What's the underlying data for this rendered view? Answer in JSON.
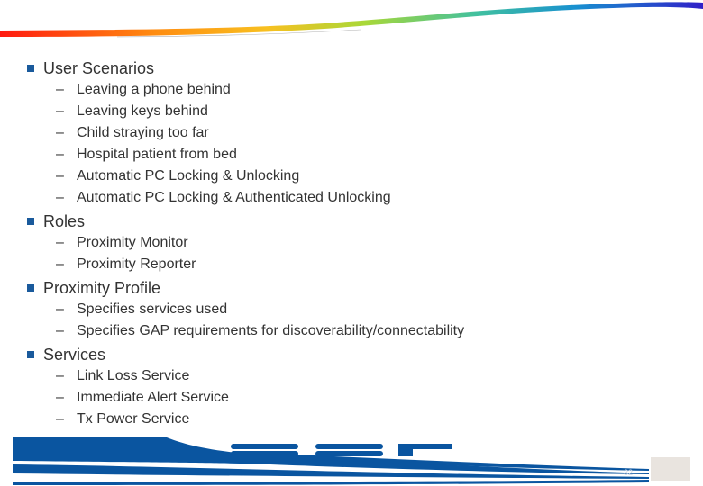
{
  "slide": {
    "sections": [
      {
        "title": "User Scenarios",
        "items": [
          "Leaving a phone behind",
          "Leaving keys behind",
          "Child straying too far",
          "Hospital patient from bed",
          "Automatic PC Locking & Unlocking",
          "Automatic PC Locking & Authenticated Unlocking"
        ]
      },
      {
        "title": "Roles",
        "items": [
          "Proximity Monitor",
          "Proximity Reporter"
        ]
      },
      {
        "title": "Proximity Profile",
        "items": [
          "Specifies services used",
          "Specifies GAP requirements for discoverability/connectability"
        ]
      },
      {
        "title": "Services",
        "items": [
          "Link Loss Service",
          "Immediate Alert Service",
          "Tx Power Service"
        ]
      }
    ],
    "dash": "–",
    "footer": {
      "logo_text": "CSR",
      "page_number": "32"
    },
    "colors": {
      "bullet": "#1a5a9c",
      "footer_blue": "#0a55a0",
      "text": "#333333"
    }
  }
}
